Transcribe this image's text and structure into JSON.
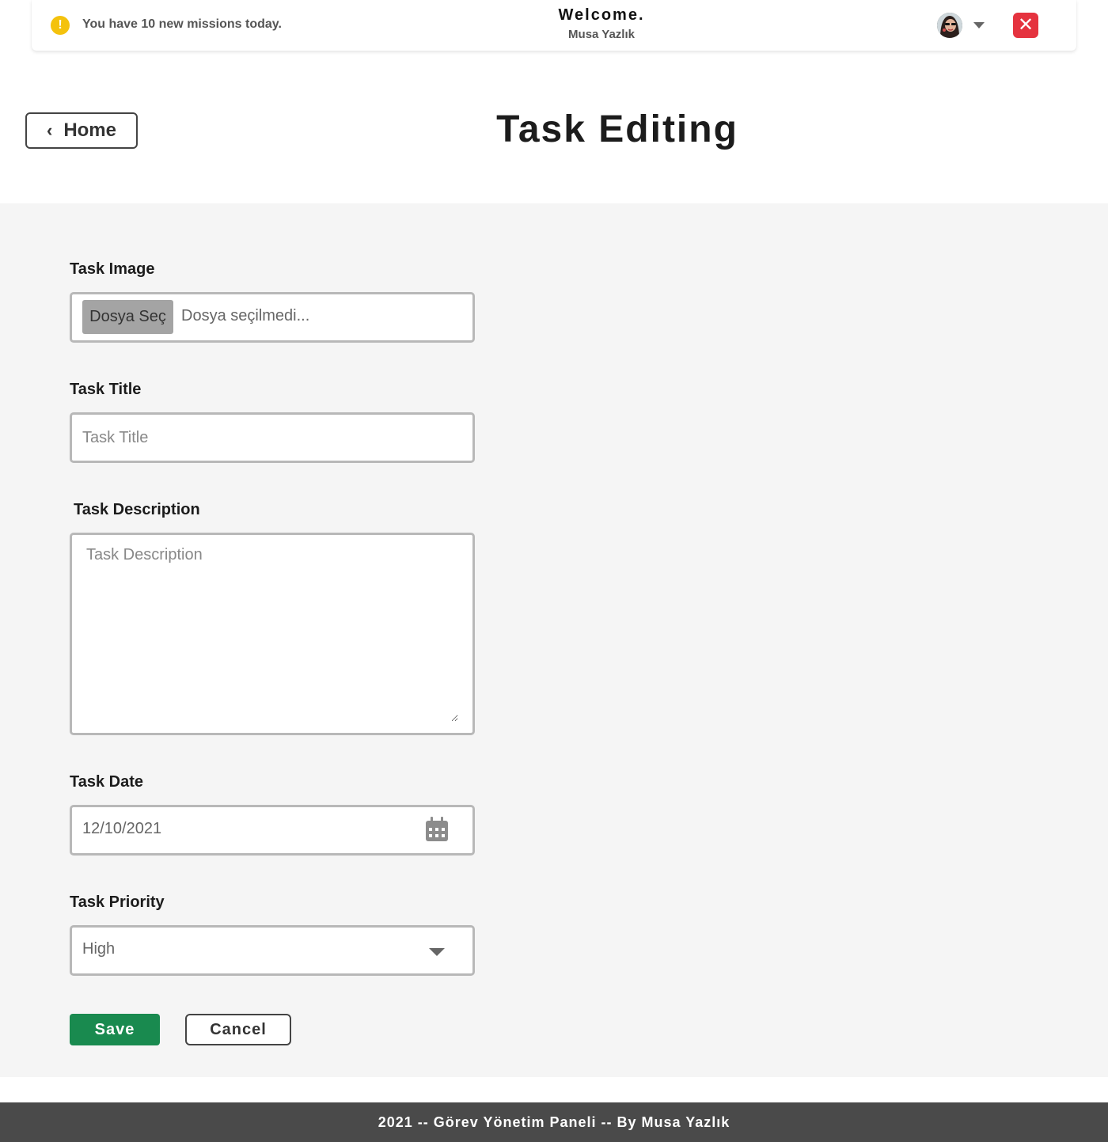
{
  "topbar": {
    "alert_icon": "exclamation-icon",
    "alert_text": "You have 10 new missions today.",
    "welcome_title": "Welcome.",
    "user_name": "Musa Yazlık",
    "avatar": "user-avatar",
    "close_icon": "close-icon",
    "close_glyph": "✕",
    "alert_glyph": "!",
    "colors": {
      "alert": "#f4c20d",
      "close": "#e5333f"
    }
  },
  "header": {
    "home_label": "Home",
    "back_glyph": "‹",
    "page_title": "Task Editing"
  },
  "form": {
    "image": {
      "label": "Task Image",
      "button": "Dosya Seç",
      "status": "Dosya seçilmedi..."
    },
    "title": {
      "label": "Task Title",
      "placeholder": "Task Title",
      "value": ""
    },
    "description": {
      "label": "Task Description",
      "placeholder": "Task Description",
      "value": ""
    },
    "date": {
      "label": "Task Date",
      "value": "12/10/2021",
      "icon": "calendar-icon"
    },
    "priority": {
      "label": "Task Priority",
      "value": "High",
      "icon": "chevron-down-icon"
    },
    "save_label": "Save",
    "cancel_label": "Cancel",
    "colors": {
      "save": "#198a4f"
    }
  },
  "footer": {
    "text": "2021 -- Görev Yönetim Paneli -- By Musa Yazlık"
  }
}
